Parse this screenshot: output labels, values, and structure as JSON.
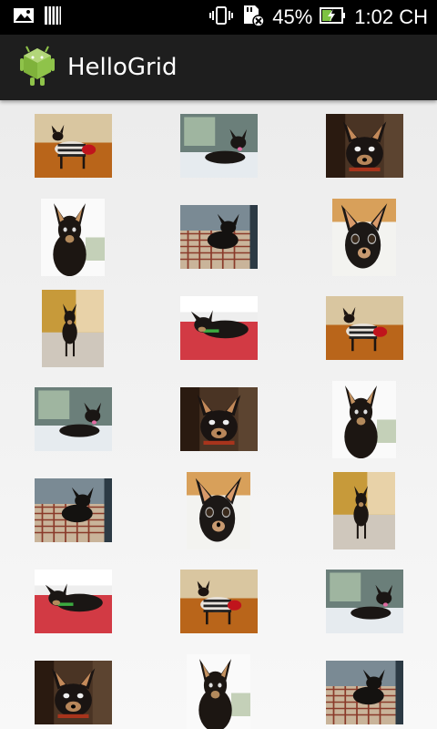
{
  "status_bar": {
    "battery_percent": "45%",
    "time": "1:02 CH",
    "icons": [
      "image-notification-icon",
      "barcode-notification-icon",
      "vibrate-icon",
      "no-sdcard-icon",
      "battery-charging-icon"
    ]
  },
  "action_bar": {
    "title": "HelloGrid",
    "icon": "android-app-icon"
  },
  "grid": {
    "columns": 3,
    "items": [
      {
        "photo": "chihuahua-sweater-standing",
        "orientation": "landscape"
      },
      {
        "photo": "chihuahua-lying-window",
        "orientation": "landscape"
      },
      {
        "photo": "chihuahua-face-dark",
        "orientation": "landscape"
      },
      {
        "photo": "chihuahua-sitting-white",
        "orientation": "portrait"
      },
      {
        "photo": "chihuahua-bed-plaid",
        "orientation": "landscape"
      },
      {
        "photo": "chihuahua-face-closeup",
        "orientation": "portrait"
      },
      {
        "photo": "chihuahua-standing-floor",
        "orientation": "tall"
      },
      {
        "photo": "chihuahua-lying-red",
        "orientation": "landscape"
      },
      {
        "photo": "chihuahua-sweater-standing",
        "orientation": "landscape"
      },
      {
        "photo": "chihuahua-lying-window",
        "orientation": "landscape"
      },
      {
        "photo": "chihuahua-face-dark",
        "orientation": "landscape"
      },
      {
        "photo": "chihuahua-sitting-white",
        "orientation": "portrait"
      },
      {
        "photo": "chihuahua-bed-plaid",
        "orientation": "landscape"
      },
      {
        "photo": "chihuahua-face-closeup",
        "orientation": "portrait"
      },
      {
        "photo": "chihuahua-standing-floor",
        "orientation": "tall"
      },
      {
        "photo": "chihuahua-lying-red",
        "orientation": "landscape"
      },
      {
        "photo": "chihuahua-sweater-standing",
        "orientation": "landscape"
      },
      {
        "photo": "chihuahua-lying-window",
        "orientation": "landscape"
      },
      {
        "photo": "chihuahua-face-dark",
        "orientation": "landscape"
      },
      {
        "photo": "chihuahua-sitting-white",
        "orientation": "portrait"
      },
      {
        "photo": "chihuahua-bed-plaid",
        "orientation": "landscape"
      }
    ]
  }
}
